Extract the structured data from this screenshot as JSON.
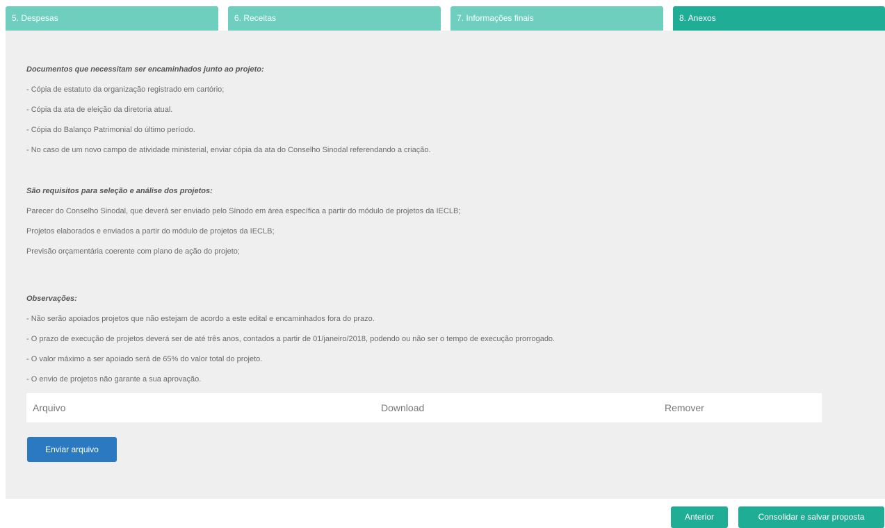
{
  "tabs": [
    {
      "label": "5. Despesas"
    },
    {
      "label": "6. Receitas"
    },
    {
      "label": "7. Informações finais"
    },
    {
      "label": "8. Anexos"
    }
  ],
  "documents": {
    "heading": "Documentos que necessitam ser encaminhados junto ao projeto:",
    "items": [
      "- Cópia de estatuto da organização registrado em cartório;",
      "- Cópia da ata de eleição da diretoria atual.",
      "- Cópia do Balanço Patrimonial do último período.",
      "- No caso de um novo campo de atividade ministerial, enviar cópia da ata do Conselho Sinodal referendando a criação."
    ]
  },
  "requirements": {
    "heading": "São requisitos para seleção e análise dos projetos:",
    "items": [
      "Parecer do Conselho Sinodal, que deverá ser enviado pelo Sínodo em área específica a partir do módulo de projetos da IECLB;",
      "Projetos elaborados e enviados a partir do módulo de projetos da IECLB;",
      "Previsão orçamentária coerente com plano de ação do projeto;"
    ]
  },
  "observations": {
    "heading": "Observações:",
    "items": [
      "- Não serão apoiados projetos que não estejam de acordo a este edital e encaminhados fora do prazo.",
      "- O prazo de execução de projetos deverá ser de até três anos, contados a partir de 01/janeiro/2018, podendo ou não ser o tempo de execução prorrogado.",
      "- O valor máximo a ser apoiado será de 65% do valor total do projeto.",
      "- O envio de projetos não garante a sua aprovação."
    ]
  },
  "files_table": {
    "columns": [
      "Arquivo",
      "Download",
      "Remover"
    ]
  },
  "buttons": {
    "upload": "Enviar arquivo",
    "previous": "Anterior",
    "save": "Consolidar e salvar proposta"
  },
  "colors": {
    "tab_inactive": "#6ecfbe",
    "tab_active": "#1fae95",
    "panel_bg": "#efefef",
    "upload_button": "#2b7ac1",
    "nav_button": "#1fae95"
  }
}
